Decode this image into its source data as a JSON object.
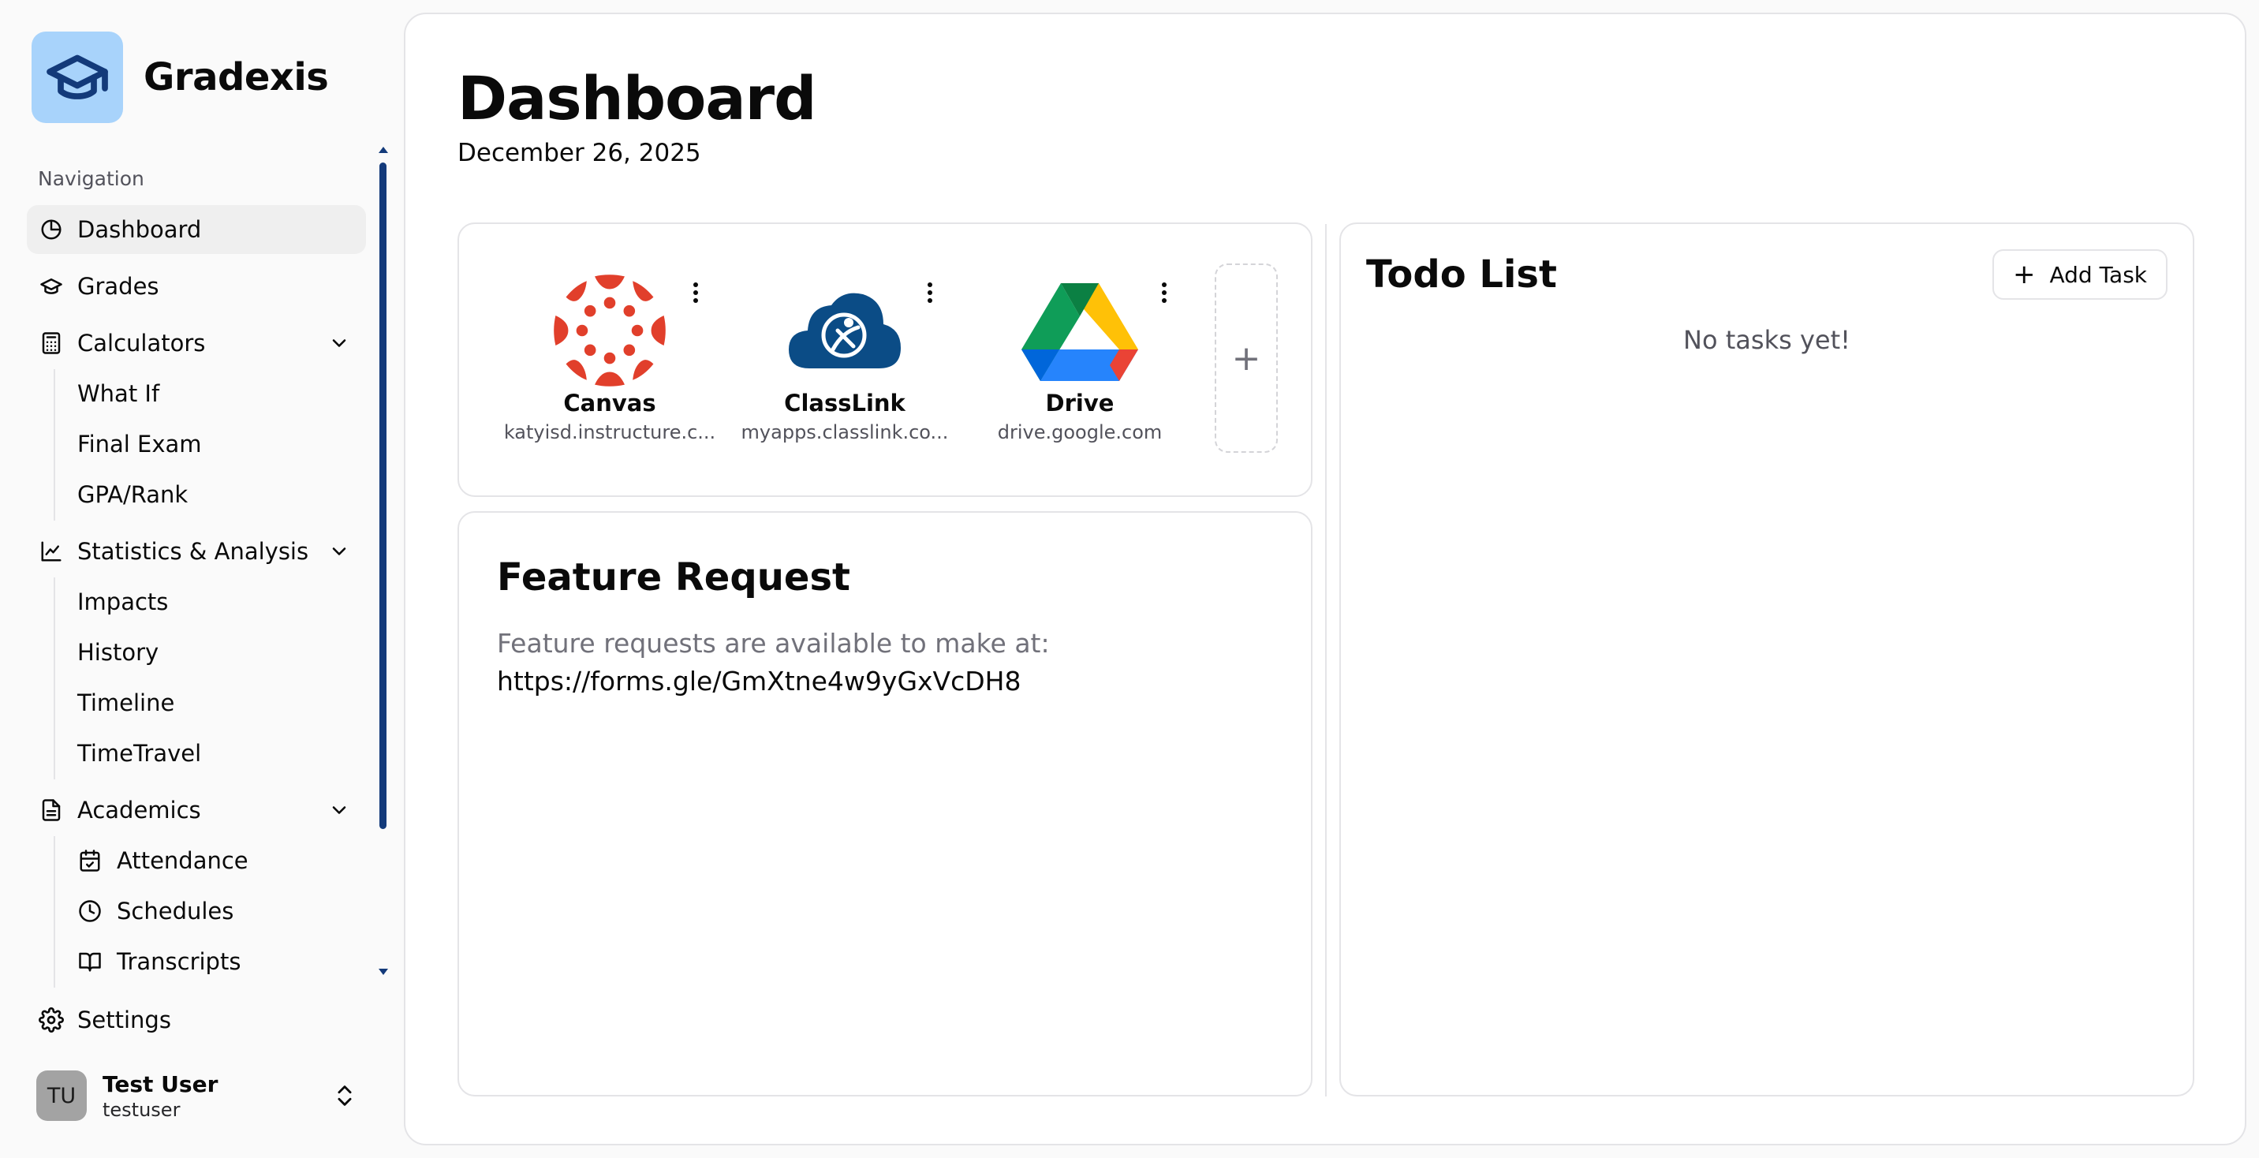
{
  "brand": {
    "name": "Gradexis"
  },
  "sidebar": {
    "heading": "Navigation",
    "items": [
      {
        "label": "Dashboard"
      },
      {
        "label": "Grades"
      },
      {
        "label": "Calculators",
        "children": [
          "What If",
          "Final Exam",
          "GPA/Rank"
        ]
      },
      {
        "label": "Statistics & Analysis",
        "children": [
          "Impacts",
          "History",
          "Timeline",
          "TimeTravel"
        ]
      },
      {
        "label": "Academics",
        "children": [
          "Attendance",
          "Schedules",
          "Transcripts"
        ]
      }
    ],
    "settings": "Settings"
  },
  "user": {
    "initials": "TU",
    "name": "Test User",
    "handle": "testuser"
  },
  "main": {
    "title": "Dashboard",
    "date": "December 26, 2025"
  },
  "apps": [
    {
      "name": "Canvas",
      "url": "katyisd.instructure.c..."
    },
    {
      "name": "ClassLink",
      "url": "myapps.classlink.co..."
    },
    {
      "name": "Drive",
      "url": "drive.google.com"
    }
  ],
  "add_tile_symbol": "+",
  "feature": {
    "title": "Feature Request",
    "text": "Feature requests are available to make at:",
    "link": "https://forms.gle/GmXtne4w9yGxVcDH8"
  },
  "todo": {
    "title": "Todo List",
    "add_label": "Add Task",
    "empty": "No tasks yet!"
  },
  "colors": {
    "accent": "#133a7a",
    "logo_bg": "#a8d3fb",
    "canvas_red": "#e13f2b",
    "classlink_blue": "#0b4c86"
  }
}
